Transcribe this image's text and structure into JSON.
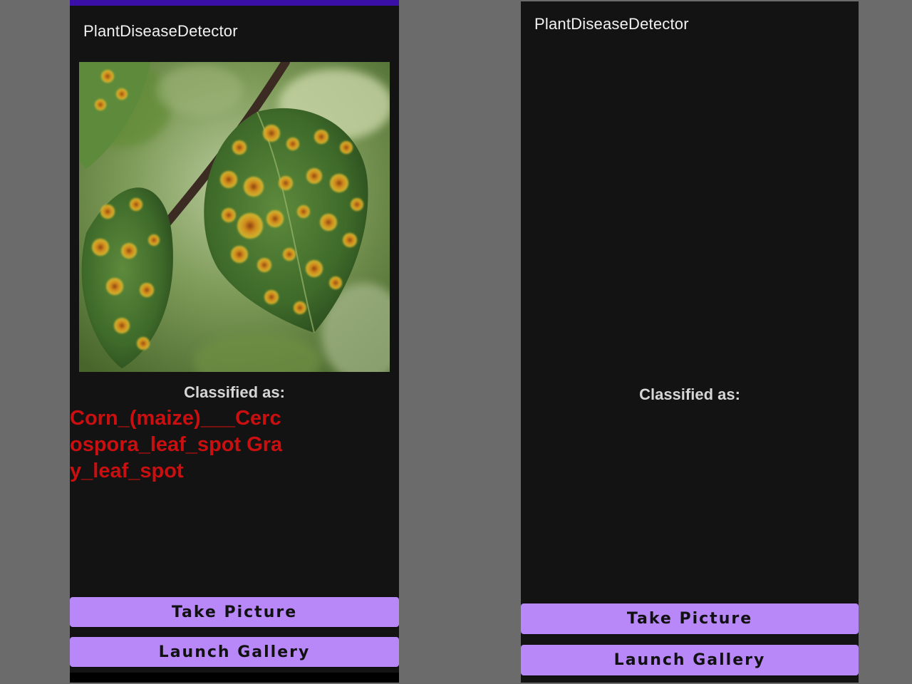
{
  "left_screen": {
    "app_title": "PlantDiseaseDetector",
    "classified_label": "Classified as:",
    "result": "Corn_(maize)___Cercospora_leaf_spot Gray_leaf_spot",
    "take_picture_label": "Take Picture",
    "launch_gallery_label": "Launch Gallery"
  },
  "right_screen": {
    "app_title": "PlantDiseaseDetector",
    "classified_label": "Classified as:",
    "take_picture_label": "Take Picture",
    "launch_gallery_label": "Launch Gallery"
  },
  "colors": {
    "background": "#6b6b6b",
    "screen": "#131313",
    "accent_bar": "#3a0fa8",
    "button": "#b888f9",
    "result_text": "#c90f0f"
  }
}
